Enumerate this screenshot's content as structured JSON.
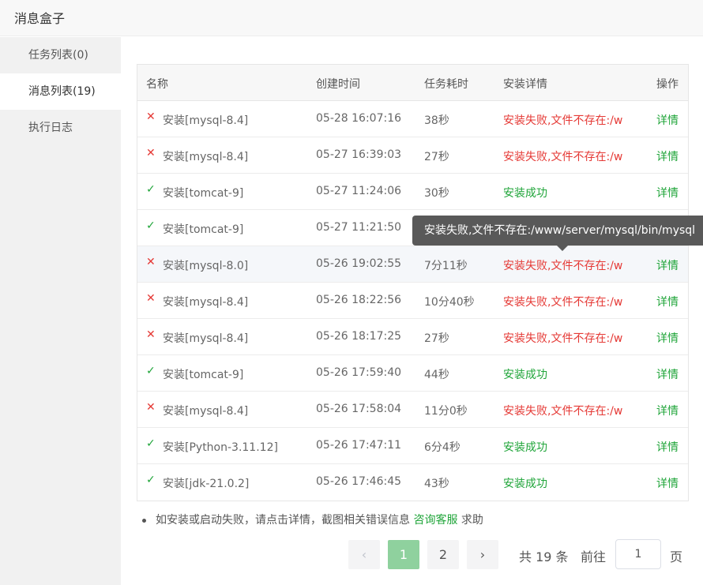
{
  "window": {
    "title": "消息盒子"
  },
  "sidebar": {
    "items": [
      {
        "label": "任务列表(0)"
      },
      {
        "label": "消息列表(19)"
      },
      {
        "label": "执行日志"
      }
    ]
  },
  "table": {
    "headers": {
      "name": "名称",
      "time": "创建时间",
      "cost": "任务耗时",
      "detail": "安装详情",
      "op": "操作"
    },
    "rows": [
      {
        "status": "fail",
        "icon": "✕",
        "name": "安装[mysql-8.4]",
        "time": "05-28 16:07:16",
        "cost": "38秒",
        "detail": "安装失败,文件不存在:/w",
        "op": "详情"
      },
      {
        "status": "fail",
        "icon": "✕",
        "name": "安装[mysql-8.4]",
        "time": "05-27 16:39:03",
        "cost": "27秒",
        "detail": "安装失败,文件不存在:/w",
        "op": "详情"
      },
      {
        "status": "ok",
        "icon": "✓",
        "name": "安装[tomcat-9]",
        "time": "05-27 11:24:06",
        "cost": "30秒",
        "detail": "安装成功",
        "op": "详情"
      },
      {
        "status": "ok",
        "icon": "✓",
        "name": "安装[tomcat-9]",
        "time": "05-27 11:21:50",
        "cost": "",
        "detail": "",
        "op": ""
      },
      {
        "status": "fail",
        "icon": "✕",
        "name": "安装[mysql-8.0]",
        "time": "05-26 19:02:55",
        "cost": "7分11秒",
        "detail": "安装失败,文件不存在:/w",
        "op": "详情"
      },
      {
        "status": "fail",
        "icon": "✕",
        "name": "安装[mysql-8.4]",
        "time": "05-26 18:22:56",
        "cost": "10分40秒",
        "detail": "安装失败,文件不存在:/w",
        "op": "详情"
      },
      {
        "status": "fail",
        "icon": "✕",
        "name": "安装[mysql-8.4]",
        "time": "05-26 18:17:25",
        "cost": "27秒",
        "detail": "安装失败,文件不存在:/w",
        "op": "详情"
      },
      {
        "status": "ok",
        "icon": "✓",
        "name": "安装[tomcat-9]",
        "time": "05-26 17:59:40",
        "cost": "44秒",
        "detail": "安装成功",
        "op": "详情"
      },
      {
        "status": "fail",
        "icon": "✕",
        "name": "安装[mysql-8.4]",
        "time": "05-26 17:58:04",
        "cost": "11分0秒",
        "detail": "安装失败,文件不存在:/w",
        "op": "详情"
      },
      {
        "status": "ok",
        "icon": "✓",
        "name": "安装[Python-3.11.12]",
        "time": "05-26 17:47:11",
        "cost": "6分4秒",
        "detail": "安装成功",
        "op": "详情"
      },
      {
        "status": "ok",
        "icon": "✓",
        "name": "安装[jdk-21.0.2]",
        "time": "05-26 17:46:45",
        "cost": "43秒",
        "detail": "安装成功",
        "op": "详情"
      }
    ]
  },
  "tooltip": {
    "text": "安装失败,文件不存在:/www/server/mysql/bin/mysql"
  },
  "tip": {
    "text": "如安装或启动失败，请点击详情，截图相关错误信息",
    "link": "咨询客服",
    "suffix": "求助"
  },
  "pager": {
    "prev": "‹",
    "pages": [
      "1",
      "2"
    ],
    "next": "›",
    "total": "共 19 条",
    "goto_label": "前往",
    "goto_value": "1",
    "page_unit": "页"
  },
  "colors": {
    "accent": "#20a53a",
    "error": "#e53935",
    "active_page": "#8fd19e"
  }
}
